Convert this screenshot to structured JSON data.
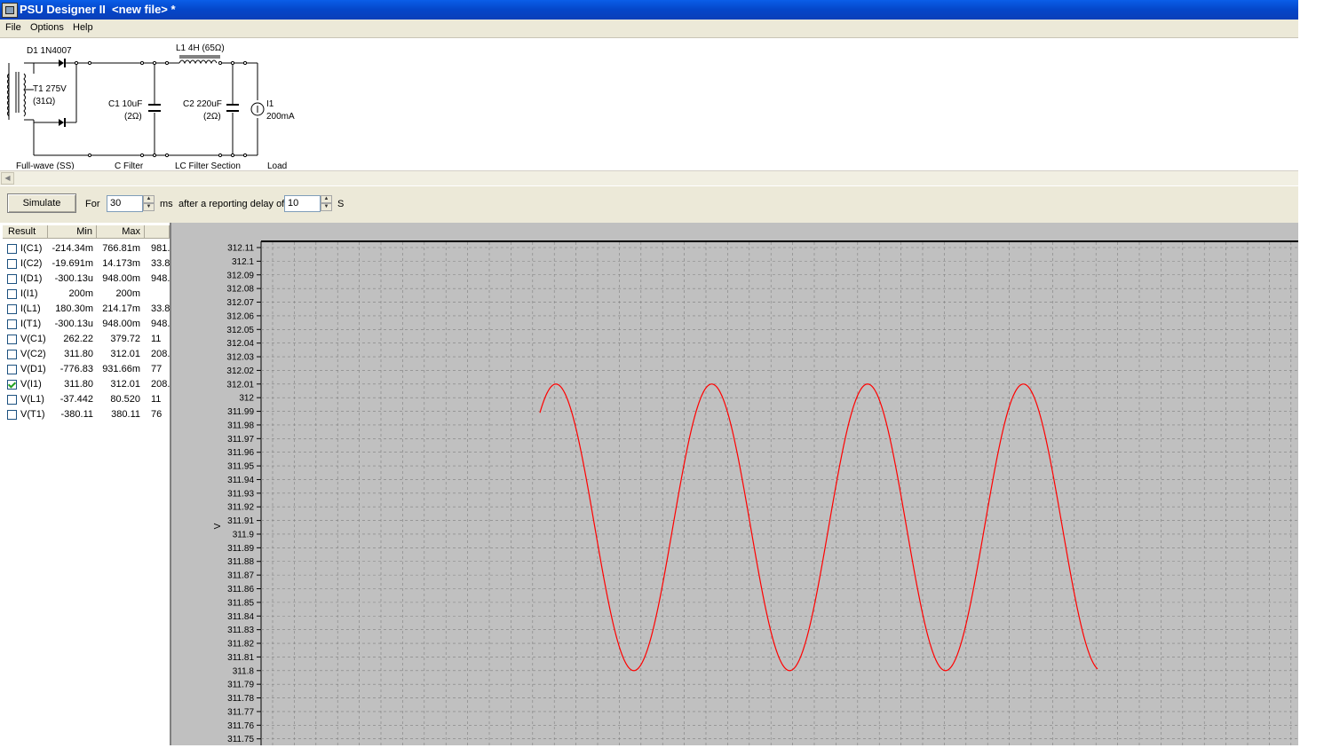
{
  "window": {
    "title": "PSU Designer II  <new file> *"
  },
  "menu": [
    "File",
    "Options",
    "Help"
  ],
  "schematic": {
    "d1": "D1 1N4007",
    "l1": "L1 4H (65Ω)",
    "t1_line1": "T1 275V",
    "t1_line2": "(31Ω)",
    "c1_line1": "C1 10uF",
    "c1_line2": "(2Ω)",
    "c2_line1": "C2 220uF",
    "c2_line2": "(2Ω)",
    "i1_line1": "I1",
    "i1_line2": "200mA",
    "sections": [
      "Full-wave (SS)",
      "C Filter",
      "LC Filter Section",
      "Load"
    ]
  },
  "toolbar": {
    "simulate": "Simulate",
    "for_label": "For",
    "duration": "30",
    "ms_label": "ms",
    "delay_label": "after a reporting delay of",
    "delay": "10",
    "s_label": "S"
  },
  "results": {
    "headers": [
      "Result",
      "Min",
      "Max"
    ],
    "rows": [
      {
        "name": "I(C1)",
        "min": "-214.34m",
        "max": "766.81m",
        "extra": "981.",
        "checked": false
      },
      {
        "name": "I(C2)",
        "min": "-19.691m",
        "max": "14.173m",
        "extra": "33.8",
        "checked": false
      },
      {
        "name": "I(D1)",
        "min": "-300.13u",
        "max": "948.00m",
        "extra": "948.",
        "checked": false
      },
      {
        "name": "I(I1)",
        "min": "200m",
        "max": "200m",
        "extra": "",
        "checked": false
      },
      {
        "name": "I(L1)",
        "min": "180.30m",
        "max": "214.17m",
        "extra": "33.8",
        "checked": false
      },
      {
        "name": "I(T1)",
        "min": "-300.13u",
        "max": "948.00m",
        "extra": "948.",
        "checked": false
      },
      {
        "name": "V(C1)",
        "min": "262.22",
        "max": "379.72",
        "extra": "11",
        "checked": false
      },
      {
        "name": "V(C2)",
        "min": "311.80",
        "max": "312.01",
        "extra": "208.",
        "checked": false
      },
      {
        "name": "V(D1)",
        "min": "-776.83",
        "max": "931.66m",
        "extra": "77",
        "checked": false
      },
      {
        "name": "V(I1)",
        "min": "311.80",
        "max": "312.01",
        "extra": "208.",
        "checked": true
      },
      {
        "name": "V(L1)",
        "min": "-37.442",
        "max": "80.520",
        "extra": "11",
        "checked": false
      },
      {
        "name": "V(T1)",
        "min": "-380.11",
        "max": "380.11",
        "extra": "76",
        "checked": false
      }
    ]
  },
  "chart_data": {
    "type": "line",
    "ylabel": "V",
    "y_ticks": [
      "312.11",
      "312.1",
      "312.09",
      "312.08",
      "312.07",
      "312.06",
      "312.05",
      "312.04",
      "312.03",
      "312.02",
      "312.01",
      "312",
      "311.99",
      "311.98",
      "311.97",
      "311.96",
      "311.95",
      "311.94",
      "311.93",
      "311.92",
      "311.91",
      "311.9",
      "311.89",
      "311.88",
      "311.87",
      "311.86",
      "311.85",
      "311.84",
      "311.83",
      "311.82",
      "311.81",
      "311.8",
      "311.79",
      "311.78",
      "311.77",
      "311.76",
      "311.75"
    ],
    "ylim": [
      311.75,
      312.11
    ],
    "series": [
      {
        "color": "#ff0000",
        "min": 311.8,
        "max": 312.01,
        "start_value": 312.0,
        "end_value": 311.805,
        "peaks": 4,
        "troughs": 4
      }
    ],
    "grid": true
  }
}
